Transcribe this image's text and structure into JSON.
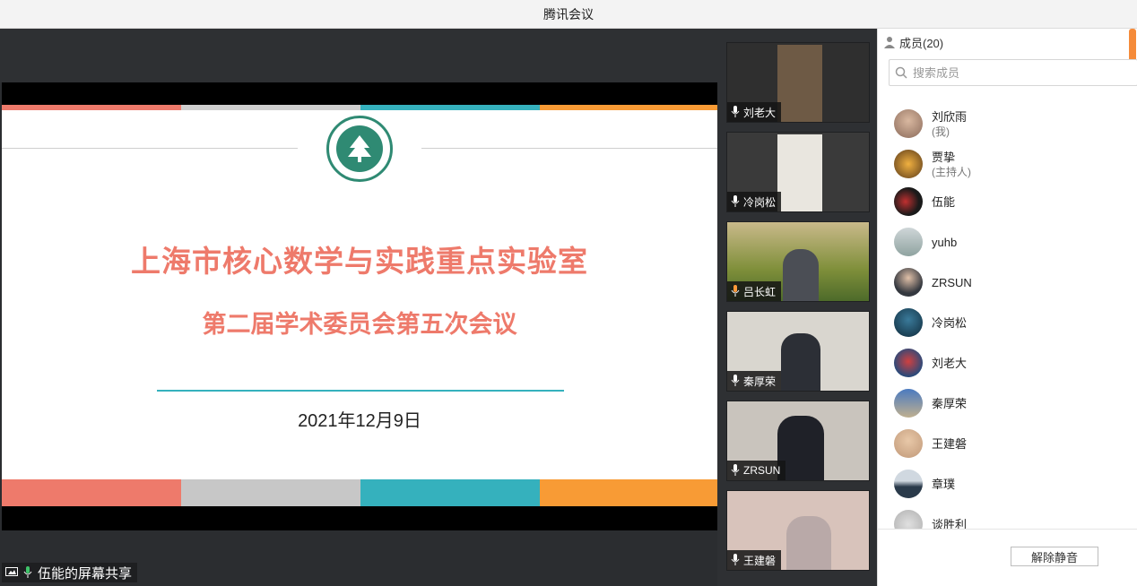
{
  "window": {
    "title": "腾讯会议"
  },
  "slide": {
    "main_title": "上海市核心数学与实践重点实验室",
    "sub_title": "第二届学术委员会第五次会议",
    "date": "2021年12月9日"
  },
  "share": {
    "label": "伍能的屏幕共享"
  },
  "videos": [
    {
      "name": "刘老大"
    },
    {
      "name": "冷岗松"
    },
    {
      "name": "吕长虹"
    },
    {
      "name": "秦厚荣"
    },
    {
      "name": "ZRSUN"
    },
    {
      "name": "王建磐"
    }
  ],
  "members_panel": {
    "header": "成员(20)",
    "search_placeholder": "搜索成员",
    "members": [
      {
        "name": "刘欣雨",
        "role": "(我)"
      },
      {
        "name": "贾挚",
        "role": "(主持人)"
      },
      {
        "name": "伍能",
        "role": ""
      },
      {
        "name": "yuhb",
        "role": ""
      },
      {
        "name": "ZRSUN",
        "role": ""
      },
      {
        "name": "冷岗松",
        "role": ""
      },
      {
        "name": "刘老大",
        "role": ""
      },
      {
        "name": "秦厚荣",
        "role": ""
      },
      {
        "name": "王建磐",
        "role": ""
      },
      {
        "name": "章璞",
        "role": ""
      },
      {
        "name": "谈胜利",
        "role": ""
      }
    ],
    "unmute_label": "解除静音"
  },
  "colors": {
    "slide_accent": "#ee7a6b",
    "teal": "#35b1bd",
    "orange": "#f89b35",
    "scrollbar": "#f58b3a"
  }
}
